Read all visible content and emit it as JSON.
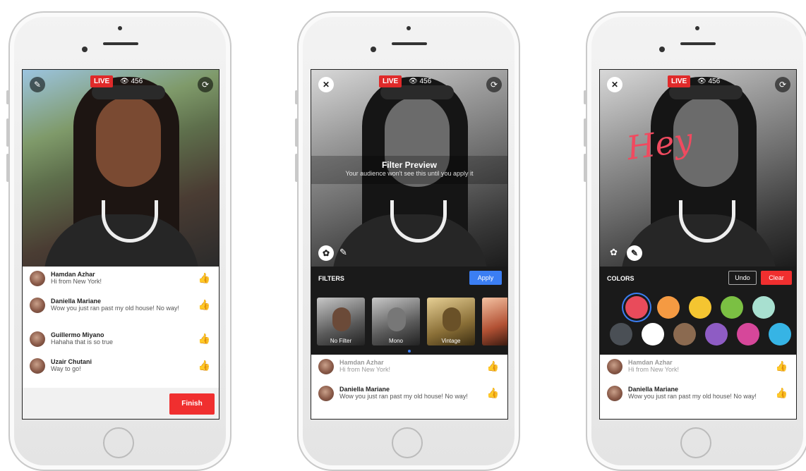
{
  "phone1": {
    "live_label": "LIVE",
    "viewers": "456",
    "comments": [
      {
        "name": "Hamdan Azhar",
        "text": "Hi from New York!"
      },
      {
        "name": "Daniella Mariane",
        "text": "Wow you just ran past my old house! No way!"
      },
      {
        "name": "Guillermo Miyano",
        "text": "Hahaha that is so true"
      },
      {
        "name": "Uzair Chutani",
        "text": "Way to go!"
      }
    ],
    "finish_label": "Finish"
  },
  "phone2": {
    "live_label": "LIVE",
    "viewers": "456",
    "preview_title": "Filter Preview",
    "preview_subtitle": "Your audience won't see this until you apply it",
    "filters_label": "FILTERS",
    "apply_label": "Apply",
    "filters": [
      {
        "label": "No Filter"
      },
      {
        "label": "Mono"
      },
      {
        "label": "Vintage"
      },
      {
        "label": ""
      }
    ],
    "comments": [
      {
        "name": "Hamdan Azhar",
        "text": "Hi from New York!"
      },
      {
        "name": "Daniella Mariane",
        "text": "Wow you just ran past my old house! No way!"
      }
    ]
  },
  "phone3": {
    "live_label": "LIVE",
    "viewers": "456",
    "drawn_text": "Hey",
    "colors_label": "COLORS",
    "undo_label": "Undo",
    "clear_label": "Clear",
    "palette": [
      "#e94b5b",
      "#f59a42",
      "#f4c531",
      "#7bc043",
      "#a8e0d0",
      "#4a4f55",
      "#ffffff",
      "#8b6a50",
      "#8e5cc4",
      "#d6479a",
      "#36b4e5"
    ],
    "comments": [
      {
        "name": "Hamdan Azhar",
        "text": "Hi from New York!"
      },
      {
        "name": "Daniella Mariane",
        "text": "Wow you just ran past my old house! No way!"
      }
    ]
  },
  "colors": {
    "live_red": "#e02a2a",
    "finish_red": "#f02f2f",
    "apply_blue": "#3b7ef3"
  }
}
